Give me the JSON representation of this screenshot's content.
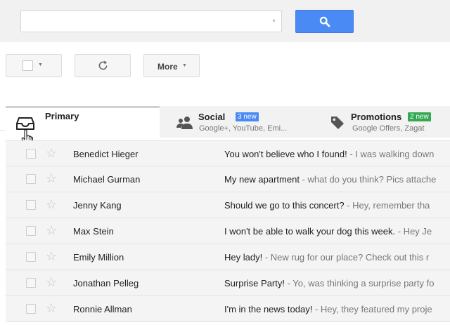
{
  "search": {
    "value": "",
    "placeholder": ""
  },
  "toolbar": {
    "more_label": "More"
  },
  "tabs": [
    {
      "id": "primary",
      "title": "Primary",
      "badge": "",
      "subtitle": "",
      "icon": "inbox-icon"
    },
    {
      "id": "social",
      "title": "Social",
      "badge": "3 new",
      "badge_color": "#4a8af4",
      "subtitle": "Google+, YouTube, Emi...",
      "icon": "people-icon"
    },
    {
      "id": "promotions",
      "title": "Promotions",
      "badge": "2 new",
      "badge_color": "#35a853",
      "subtitle": "Google Offers, Zagat",
      "icon": "tag-icon"
    }
  ],
  "messages": [
    {
      "sender": "Benedict Hieger",
      "subject": "You won't believe who I found!",
      "snippet": " - I was walking down"
    },
    {
      "sender": "Michael Gurman",
      "subject": "My new apartment",
      "snippet": " - what do you think? Pics attache"
    },
    {
      "sender": "Jenny Kang",
      "subject": "Should we go to this concert?",
      "snippet": " - Hey, remember tha"
    },
    {
      "sender": "Max Stein",
      "subject": "I won't be able to walk your dog this week.",
      "snippet": " - Hey Je"
    },
    {
      "sender": "Emily Million",
      "subject": "Hey lady!",
      "snippet": " - New rug for our place? Check out this r"
    },
    {
      "sender": "Jonathan Pelleg",
      "subject": "Surprise Party!",
      "snippet": " - Yo, was thinking a surprise party fo"
    },
    {
      "sender": "Ronnie Allman",
      "subject": "I'm in the news today!",
      "snippet": " - Hey, they featured my proje"
    }
  ],
  "colors": {
    "accent": "#4a8af4",
    "new_badge_social": "#4a8af4",
    "new_badge_promotions": "#35a853"
  }
}
